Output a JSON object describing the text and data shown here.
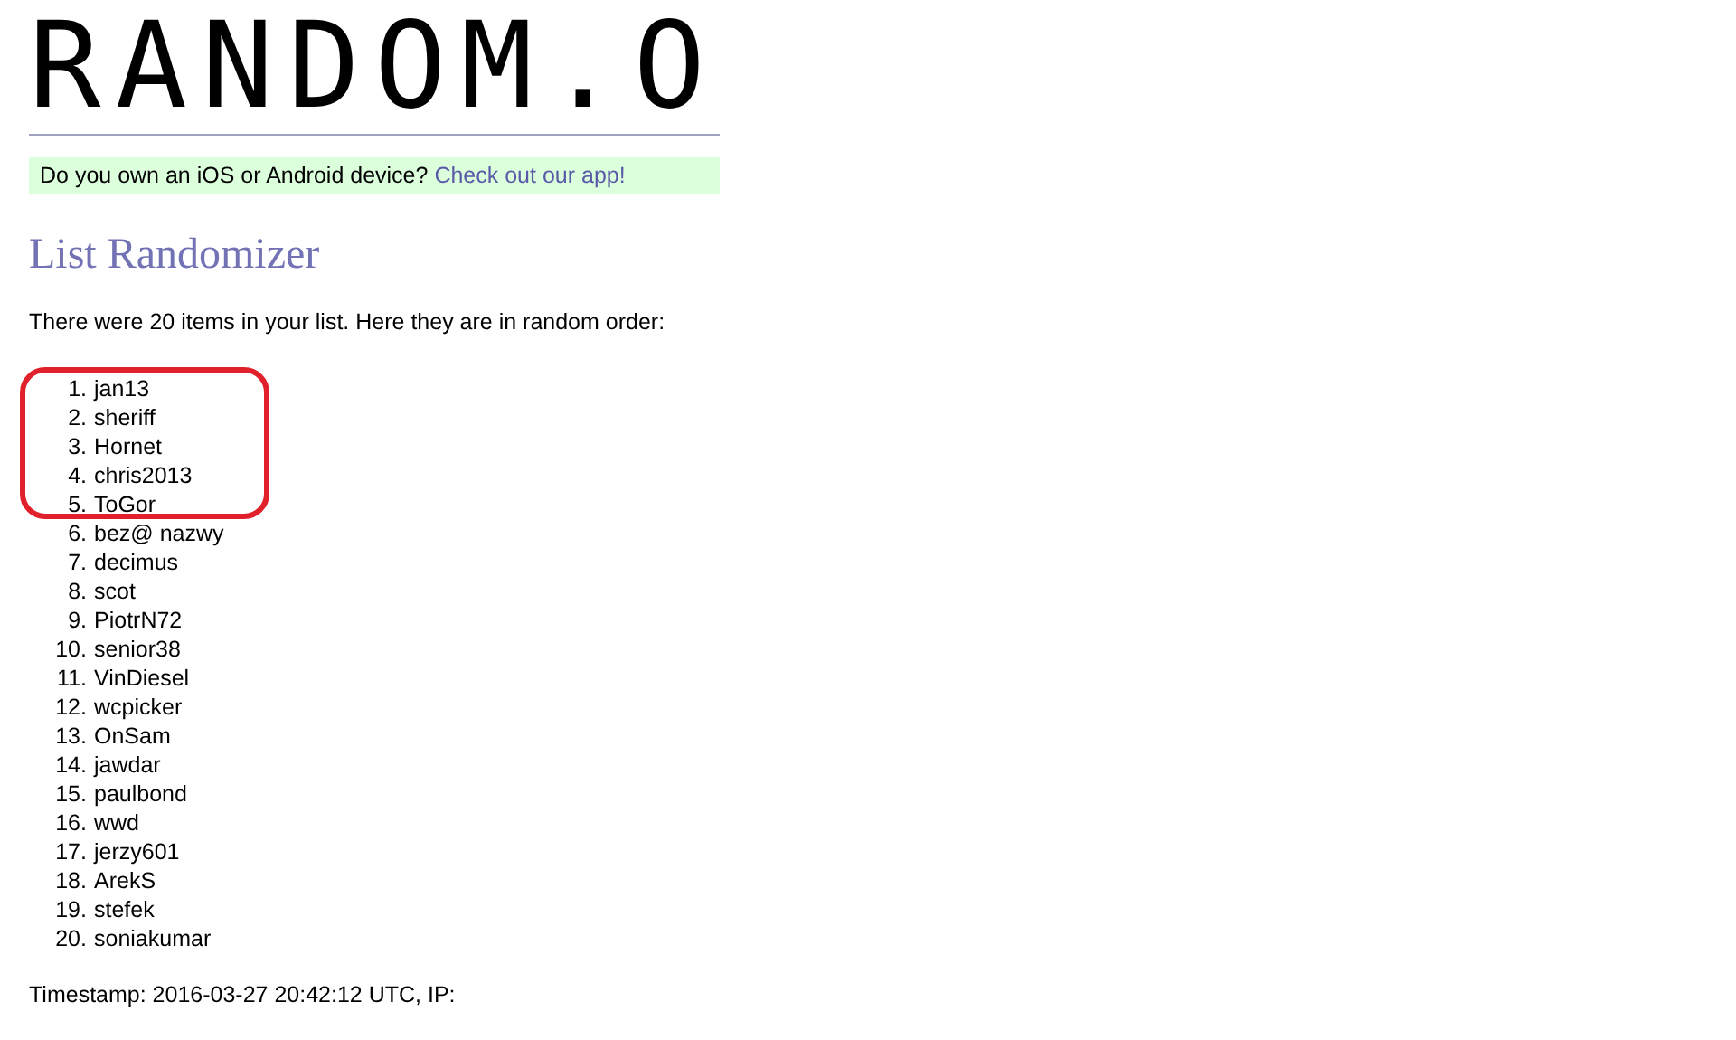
{
  "logo": "RANDOM.O",
  "app_banner": {
    "text": "Do you own an iOS or Android device?",
    "link": "Check out our app!"
  },
  "title": "List Randomizer",
  "intro": "There were 20 items in your list. Here they are in random order:",
  "items": [
    {
      "number": "1.",
      "text": "jan13"
    },
    {
      "number": "2.",
      "text": "sheriff"
    },
    {
      "number": "3.",
      "text": "Hornet"
    },
    {
      "number": "4.",
      "text": "chris2013"
    },
    {
      "number": "5.",
      "text": "ToGor"
    },
    {
      "number": "6.",
      "text": "bez@ nazwy"
    },
    {
      "number": "7.",
      "text": "decimus"
    },
    {
      "number": "8.",
      "text": "scot"
    },
    {
      "number": "9.",
      "text": "PiotrN72"
    },
    {
      "number": "10.",
      "text": "senior38"
    },
    {
      "number": "11.",
      "text": "VinDiesel"
    },
    {
      "number": "12.",
      "text": "wcpicker"
    },
    {
      "number": "13.",
      "text": "OnSam"
    },
    {
      "number": "14.",
      "text": "jawdar"
    },
    {
      "number": "15.",
      "text": "paulbond"
    },
    {
      "number": "16.",
      "text": "wwd"
    },
    {
      "number": "17.",
      "text": "jerzy601"
    },
    {
      "number": "18.",
      "text": "ArekS"
    },
    {
      "number": "19.",
      "text": "stefek"
    },
    {
      "number": "20.",
      "text": "soniakumar"
    }
  ],
  "timestamp": "Timestamp: 2016-03-27 20:42:12 UTC, IP:"
}
